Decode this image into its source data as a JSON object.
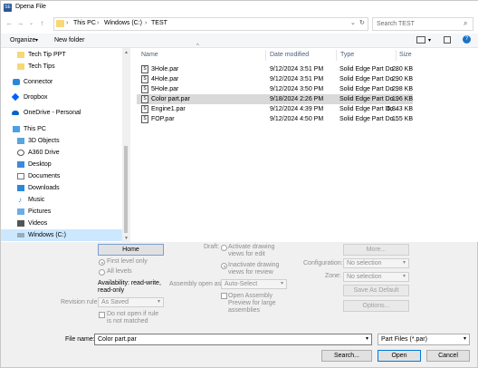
{
  "window": {
    "title": "Dpena File"
  },
  "address": {
    "segments": [
      "This PC",
      "Windows (C:)",
      "TEST"
    ],
    "search_placeholder": "Search TEST"
  },
  "toolbar": {
    "organize": "Organize",
    "new_folder": "New folder"
  },
  "nav": {
    "items": [
      {
        "label": "Tech Tip PPT",
        "icon": "folder-icon"
      },
      {
        "label": "Tech Tips",
        "icon": "folder-icon"
      },
      {
        "label": "Connector",
        "icon": "connector-icon"
      },
      {
        "label": "Dropbox",
        "icon": "dropbox-icon"
      },
      {
        "label": "OneDrive - Personal",
        "icon": "onedrive-icon"
      },
      {
        "label": "This PC",
        "icon": "pc-icon"
      },
      {
        "label": "3D Objects",
        "icon": "3d-objects-icon"
      },
      {
        "label": "A360 Drive",
        "icon": "a360-drive-icon"
      },
      {
        "label": "Desktop",
        "icon": "desktop-icon"
      },
      {
        "label": "Documents",
        "icon": "documents-icon"
      },
      {
        "label": "Downloads",
        "icon": "downloads-icon"
      },
      {
        "label": "Music",
        "icon": "music-icon"
      },
      {
        "label": "Pictures",
        "icon": "pictures-icon"
      },
      {
        "label": "Videos",
        "icon": "videos-icon"
      },
      {
        "label": "Windows (C:)",
        "icon": "drive-icon"
      }
    ]
  },
  "files": {
    "headers": {
      "name": "Name",
      "date": "Date modified",
      "type": "Type",
      "size": "Size"
    },
    "rows": [
      {
        "name": "3Hole.par",
        "date": "9/12/2024 3:51 PM",
        "type": "Solid Edge Part Do...",
        "size": "280 KB"
      },
      {
        "name": "4Hole.par",
        "date": "9/12/2024 3:51 PM",
        "type": "Solid Edge Part Do...",
        "size": "290 KB"
      },
      {
        "name": "5Hole.par",
        "date": "9/12/2024 3:50 PM",
        "type": "Solid Edge Part Do...",
        "size": "298 KB"
      },
      {
        "name": "Color part.par",
        "date": "9/18/2024 2:26 PM",
        "type": "Solid Edge Part Do...",
        "size": "196 KB"
      },
      {
        "name": "Engine1.par",
        "date": "9/12/2024 4:39 PM",
        "type": "Solid Edge Part Do...",
        "size": "6,843 KB"
      },
      {
        "name": "FOP.par",
        "date": "9/12/2024 4:50 PM",
        "type": "Solid Edge Part Do...",
        "size": "155 KB"
      }
    ]
  },
  "options": {
    "home_button": "Home",
    "first_level_only": "First level only",
    "all_levels": "All levels",
    "availability": "Availability: read-write, read-only",
    "revision_rule_label": "Revision rule:",
    "revision_rule_value": "As Saved",
    "do_not_open": "Do not open if rule is not matched",
    "draft_label": "Draft:",
    "activate_drawing": "Activate drawing views for edit",
    "inactivate_drawing": "Inactivate drawing views for review",
    "assembly_open_as_label": "Assembly open as:",
    "assembly_open_as_value": "Auto-Select",
    "open_assembly_preview": "Open Assembly Preview for large assemblies",
    "more_button": "More...",
    "configuration_label": "Configuration:",
    "configuration_value": "No selection",
    "zone_label": "Zone:",
    "zone_value": "No selection",
    "save_as_default": "Save As Default",
    "options_button": "Options..."
  },
  "footer": {
    "file_name_label": "File name:",
    "file_name_value": "Color part.par",
    "file_type_value": "Part Files (*.par)",
    "search_button": "Search...",
    "open_button": "Open",
    "cancel_button": "Cancel"
  },
  "colors": {
    "accent": "#0078d7",
    "selection": "#cce8ff",
    "folder": "#f8d775"
  }
}
